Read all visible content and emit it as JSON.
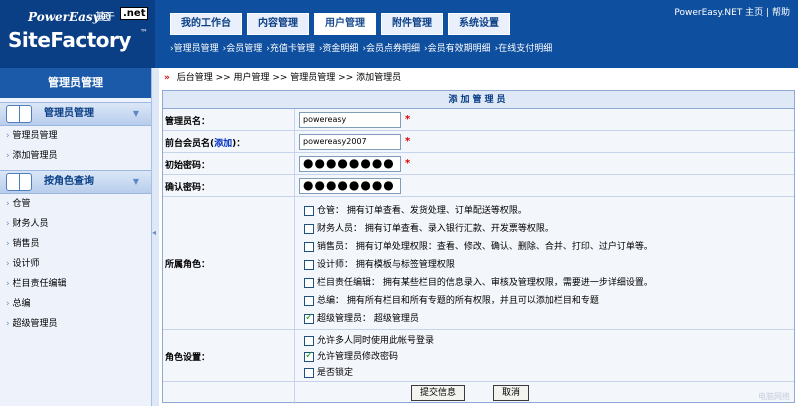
{
  "header": {
    "logo_top": "PowerEasy®",
    "logo_main": "SiteFactory",
    "logo_tm": "™",
    "logo_base": "基于",
    "logo_net": ".net",
    "tabs": [
      "我的工作台",
      "内容管理",
      "用户管理",
      "附件管理",
      "系统设置"
    ],
    "active_tab": "用户管理",
    "top_link_home": "PowerEasy.NET 主页",
    "top_link_sep": "|",
    "top_link_help": "帮助",
    "sub_menu": [
      "›管理员管理",
      "›会员管理",
      "›充值卡管理",
      "›资金明细",
      "›会员点券明细",
      "›会员有效期明细",
      "›在线支付明细"
    ]
  },
  "sidebar": {
    "title": "管理员管理",
    "group1": {
      "title": "管理员管理",
      "items": [
        "管理员管理",
        "添加管理员"
      ]
    },
    "group2": {
      "title": "按角色查询",
      "items": [
        "仓管",
        "财务人员",
        "销售员",
        "设计师",
        "栏目责任编辑",
        "总编",
        "超级管理员"
      ]
    }
  },
  "breadcrumb": {
    "arrows": "»",
    "path": "后台管理 >> 用户管理 >> 管理员管理 >> 添加管理员"
  },
  "form": {
    "title": "添加管理员",
    "admin_name_label": "管理员名：",
    "admin_name_value": "powereasy",
    "member_name_label_a": "前台会员名(",
    "member_name_link": "添加",
    "member_name_label_b": ")：",
    "member_name_value": "powereasy2007",
    "init_pw_label": "初始密码：",
    "confirm_pw_label": "确认密码：",
    "password_mask": "●●●●●●●●",
    "required_mark": "*",
    "roles_label": "所属角色：",
    "roles": [
      {
        "text": "仓管：  拥有订单查看、发货处理、订单配送等权限。",
        "checked": false
      },
      {
        "text": "财务人员：  拥有订单查看、录入银行汇款、开发票等权限。",
        "checked": false
      },
      {
        "text": "销售员：  拥有订单处理权限：查看、修改、确认、删除、合并、打印、过户订单等。",
        "checked": false
      },
      {
        "text": "设计师：  拥有模板与标签管理权限",
        "checked": false
      },
      {
        "text": "栏目责任编辑：  拥有某些栏目的信息录入、审核及管理权限，需要进一步详细设置。",
        "checked": false
      },
      {
        "text": "总编：  拥有所有栏目和所有专题的所有权限，并且可以添加栏目和专题",
        "checked": false
      },
      {
        "text": "超级管理员：  超级管理员",
        "checked": true
      }
    ],
    "settings_label": "角色设置：",
    "settings": [
      {
        "text": "允许多人同时使用此帐号登录",
        "checked": false
      },
      {
        "text": "允许管理员修改密码",
        "checked": true
      },
      {
        "text": "是否锁定",
        "checked": false
      }
    ],
    "submit_label": "提交信息",
    "cancel_label": "取消"
  },
  "watermark": "电脑网络"
}
